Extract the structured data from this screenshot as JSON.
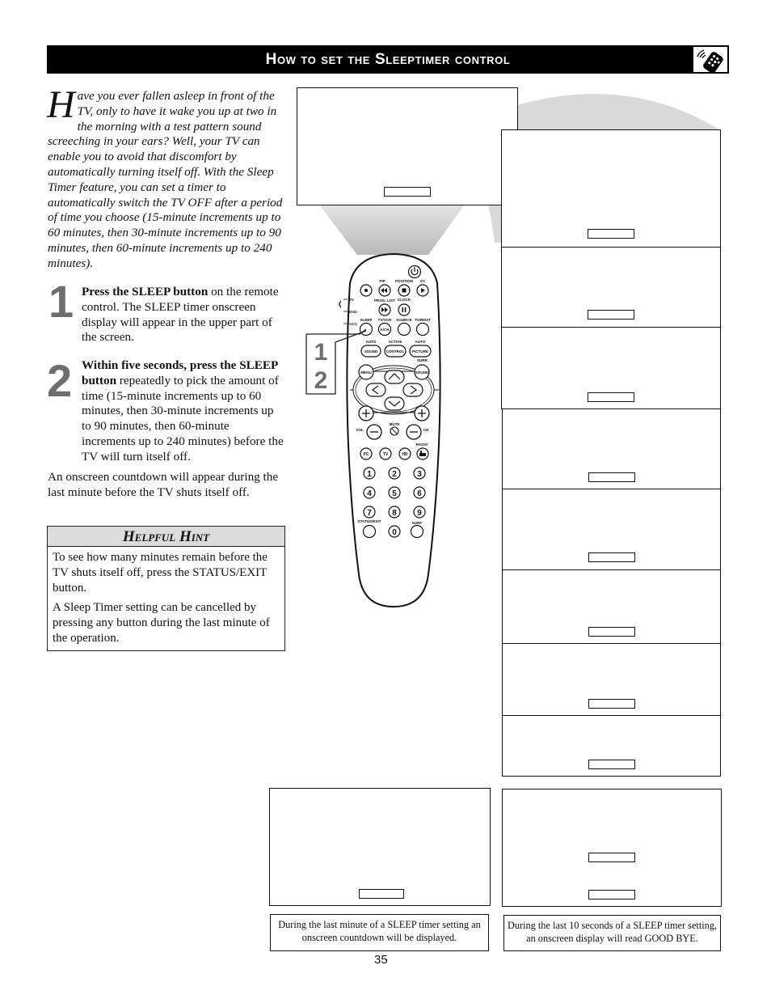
{
  "header": {
    "title": "How to set the Sleeptimer control",
    "icon": "remote-control-icon"
  },
  "intro": {
    "dropcap": "H",
    "text": "ave you ever fallen asleep in front of the TV, only to have it wake you up at two in the morning with a test pattern sound screeching in your ears?  Well, your TV can enable you to avoid that discomfort by automatically turning itself off. With the Sleep Timer feature, you can set a timer to automatically switch the TV OFF after a period of time you choose (15-minute increments up to 60 minutes, then 30-minute increments up to 90 minutes, then 60-minute increments up to 240 minutes)."
  },
  "steps": [
    {
      "number": "1",
      "bold": "Press the SLEEP button",
      "text": " on the remote control.  The SLEEP timer onscreen display will appear in the upper part of the screen."
    },
    {
      "number": "2",
      "bold": "Within five seconds, press the SLEEP button",
      "text": " repeatedly to pick the amount of time (15-minute increments up to 60 minutes, then 30-minute increments up to 90 minutes, then 60-minute increments up to 240 minutes) before the TV will turn itself off."
    }
  ],
  "countdown_note": "An onscreen countdown will appear during the last minute before the TV shuts itself off.",
  "hint": {
    "title": "Helpful Hint",
    "paragraphs": [
      "To see how many minutes remain before the TV shuts itself off, press the STATUS/EXIT button.",
      "A Sleep Timer setting can be cancelled by pressing any button during the last minute of the operation."
    ]
  },
  "remote": {
    "callout_steps": [
      "1",
      "2"
    ],
    "mode_labels": [
      "TV",
      "DVD",
      "ACC"
    ],
    "row1_labels": [
      "PIP",
      "POSITION",
      "CC"
    ],
    "row2_labels": [
      "PROG. LIST",
      "CLOCK"
    ],
    "row3_labels": [
      "SLEEP",
      "TV/VCR",
      "SOURCE",
      "FORMAT"
    ],
    "row3_button": "A/CH",
    "row4_top_labels": [
      "AUTO",
      "ACTIVE",
      "AUTO"
    ],
    "row4_buttons": [
      "SOUND",
      "CONTROL",
      "PICTURE"
    ],
    "surr_label": "SURR.",
    "menu_button": "MENU",
    "sound_button": "SOUND",
    "vol_label": "VOL",
    "ch_label": "CH",
    "mute_label": "MUTE",
    "radio_label": "RADIO",
    "source_buttons": [
      "PC",
      "TV",
      "HD"
    ],
    "digits": [
      "1",
      "2",
      "3",
      "4",
      "5",
      "6",
      "7",
      "8",
      "9",
      "0"
    ],
    "status_exit_label": "STATUS/EXIT",
    "surf_label": "SURF"
  },
  "captions": {
    "countdown": "During the last minute of a SLEEP timer setting an onscreen countdown will be displayed.",
    "goodbye": "During the last 10 seconds of a SLEEP timer setting, an onscreen display will read GOOD BYE."
  },
  "page_number": "35"
}
